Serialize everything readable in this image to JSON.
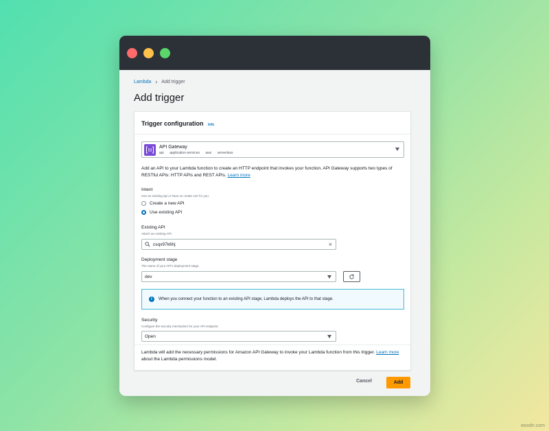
{
  "breadcrumb": {
    "root": "Lambda",
    "current": "Add trigger"
  },
  "page": {
    "title": "Add trigger"
  },
  "card": {
    "title": "Trigger configuration",
    "info": "Info"
  },
  "service": {
    "name": "API Gateway",
    "tags": [
      "api",
      "application-services",
      "aws",
      "serverless"
    ],
    "icon": "api-gateway-icon"
  },
  "description": {
    "text": "Add an API to your Lambda function to create an HTTP endpoint that invokes your function. API Gateway supports two types of RESTful APIs: HTTP APIs and REST APIs.",
    "link": "Learn more"
  },
  "intent": {
    "label": "Intent",
    "hint": "Use an existing api or have us create one for you.",
    "options": [
      {
        "label": "Create a new API",
        "checked": false
      },
      {
        "label": "Use existing API",
        "checked": true
      }
    ]
  },
  "existing_api": {
    "label": "Existing API",
    "hint": "Attach an existing API.",
    "value": "csqx97k6hj"
  },
  "deployment_stage": {
    "label": "Deployment stage",
    "hint": "The name of your API's deployment stage.",
    "value": "dev"
  },
  "alert": {
    "text": "When you connect your function to an existing API stage, Lambda deploys the API to that stage."
  },
  "security": {
    "label": "Security",
    "hint": "Configure the security mechanism for your API endpoint.",
    "value": "Open"
  },
  "footer_note": {
    "text": "Lambda will add the necessary permissions for Amazon API Gateway to invoke your Lambda function from this trigger.",
    "link": "Learn more",
    "suffix": "about the Lambda permissions model."
  },
  "actions": {
    "cancel": "Cancel",
    "add": "Add"
  },
  "watermark": "wsxdn.com",
  "colors": {
    "accent": "#0073bb",
    "primary_button": "#ff9900",
    "titlebar": "#2b3137"
  }
}
